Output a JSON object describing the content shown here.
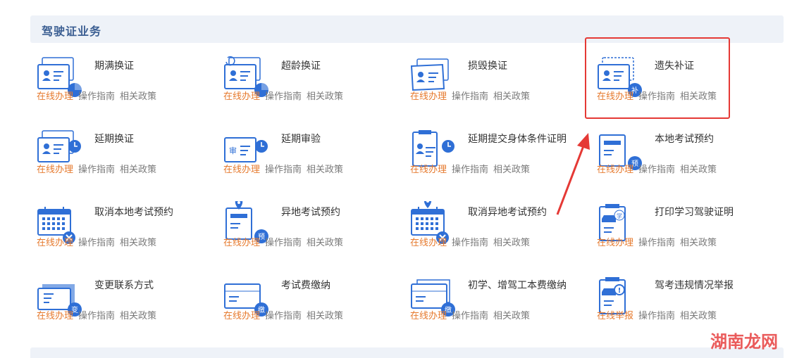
{
  "section": {
    "title": "驾驶证业务"
  },
  "cards": [
    {
      "title": "期满换证",
      "links": [
        "在线办理",
        "操作指南",
        "相关政策"
      ],
      "icon": "license-clock-icon"
    },
    {
      "title": "超龄换证",
      "links": [
        "在线办理",
        "操作指南",
        "相关政策"
      ],
      "icon": "license-refresh-icon"
    },
    {
      "title": "损毁换证",
      "links": [
        "在线办理",
        "操作指南",
        "相关政策"
      ],
      "icon": "license-damaged-icon"
    },
    {
      "title": "遗失补证",
      "links": [
        "在线办理",
        "操作指南",
        "相关政策"
      ],
      "icon": "license-reissue-icon",
      "badge": "补"
    },
    {
      "title": "延期换证",
      "links": [
        "在线办理",
        "操作指南",
        "相关政策"
      ],
      "icon": "license-clock-icon"
    },
    {
      "title": "延期审验",
      "links": [
        "在线办理",
        "操作指南",
        "相关政策"
      ],
      "icon": "review-clock-icon",
      "label": "审"
    },
    {
      "title": "延期提交身体条件证明",
      "links": [
        "在线办理",
        "操作指南",
        "相关政策"
      ],
      "icon": "health-cert-clock-icon"
    },
    {
      "title": "本地考试预约",
      "links": [
        "在线办理",
        "操作指南",
        "相关政策"
      ],
      "icon": "exam-booking-icon",
      "badge": "预"
    },
    {
      "title": "取消本地考试预约",
      "links": [
        "在线办理",
        "操作指南",
        "相关政策"
      ],
      "icon": "calendar-cancel-icon"
    },
    {
      "title": "异地考试预约",
      "links": [
        "在线办理",
        "操作指南",
        "相关政策"
      ],
      "icon": "location-booking-icon",
      "badge": "预"
    },
    {
      "title": "取消异地考试预约",
      "links": [
        "在线办理",
        "操作指南",
        "相关政策"
      ],
      "icon": "location-calendar-cancel-icon"
    },
    {
      "title": "打印学习驾驶证明",
      "links": [
        "在线办理",
        "操作指南",
        "相关政策"
      ],
      "icon": "learner-cert-icon",
      "label": "学"
    },
    {
      "title": "变更联系方式",
      "links": [
        "在线办理",
        "操作指南",
        "相关政策"
      ],
      "icon": "contact-change-icon",
      "badge": "变"
    },
    {
      "title": "考试费缴纳",
      "links": [
        "在线办理",
        "操作指南",
        "相关政策"
      ],
      "icon": "exam-fee-icon",
      "badge": "缴"
    },
    {
      "title": "初学、增驾工本费缴纳",
      "links": [
        "在线办理",
        "操作指南",
        "相关政策"
      ],
      "icon": "cost-fee-icon",
      "badge": "缴"
    },
    {
      "title": "驾考违规情况举报",
      "links": [
        "在线举报",
        "操作指南",
        "相关政策"
      ],
      "icon": "violation-report-icon"
    }
  ],
  "watermark": "湖南龙网",
  "colors": {
    "accent": "#e67a2e",
    "icon_blue": "#2f6fd6",
    "highlight": "#e53935",
    "title_blue": "#3b5e92"
  }
}
